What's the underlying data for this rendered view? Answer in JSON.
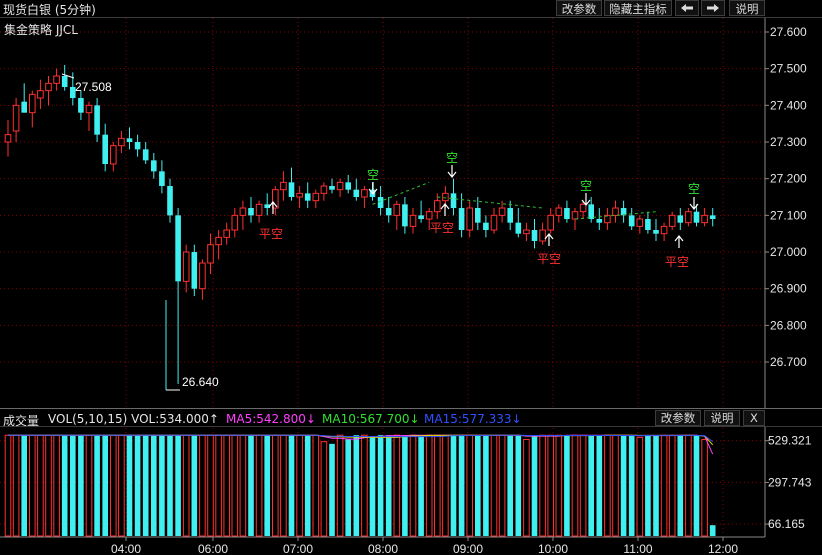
{
  "window": {
    "title": "现货白银 (5分钟)",
    "strategy": "集金策略 JJCL"
  },
  "toolbar": {
    "params": "改参数",
    "hide": "隐藏主指标",
    "left_icon": "arrow-left-icon",
    "right_icon": "arrow-right-icon",
    "help": "说明"
  },
  "price_axis": {
    "ticks": [
      "27.600",
      "27.500",
      "27.400",
      "27.300",
      "27.200",
      "27.100",
      "27.000",
      "26.900",
      "26.800",
      "26.700"
    ]
  },
  "time_axis": {
    "labels": [
      "04:00",
      "06:00",
      "07:00",
      "08:00",
      "09:00",
      "10:00",
      "11:00",
      "12:00"
    ]
  },
  "annotations": {
    "high": "27.508",
    "low": "26.640"
  },
  "signals": [
    {
      "text": "平空",
      "kind": "cover"
    },
    {
      "text": "空",
      "kind": "short"
    },
    {
      "text": "空",
      "kind": "short"
    },
    {
      "text": "平空",
      "kind": "cover"
    },
    {
      "text": "平空",
      "kind": "cover"
    },
    {
      "text": "空",
      "kind": "short"
    },
    {
      "text": "平空",
      "kind": "cover"
    },
    {
      "text": "空",
      "kind": "short"
    }
  ],
  "volume": {
    "label": "成交量",
    "vol": "VOL(5,10,15) VOL:534.000↑",
    "ma5": "MA5:542.800↓",
    "ma10": "MA10:567.700↓",
    "ma15": "MA15:577.333↓",
    "params": "改参数",
    "help": "说明",
    "close": "X",
    "ticks": [
      "529.321",
      "297.743",
      "66.165"
    ]
  },
  "colors": {
    "up": "#ff3030",
    "down": "#40f0f0",
    "ma5": "#ff40ff",
    "ma10": "#e0e000",
    "ma15": "#3050ff",
    "grid": "#8b0000",
    "signal_short": "#30e030",
    "signal_cover": "#ff3030"
  },
  "chart_data": {
    "type": "candlestick",
    "price_range": [
      26.6,
      27.63
    ],
    "price_ticks": [
      26.7,
      26.8,
      26.9,
      27.0,
      27.1,
      27.2,
      27.3,
      27.4,
      27.5,
      27.6
    ],
    "time_labels": [
      "04:00",
      "06:00",
      "07:00",
      "08:00",
      "09:00",
      "10:00",
      "11:00",
      "12:00"
    ],
    "candles": [
      [
        27.3,
        27.36,
        27.26,
        27.32
      ],
      [
        27.33,
        27.42,
        27.3,
        27.4
      ],
      [
        27.41,
        27.46,
        27.38,
        27.38
      ],
      [
        27.38,
        27.44,
        27.34,
        27.43
      ],
      [
        27.42,
        27.47,
        27.39,
        27.44
      ],
      [
        27.44,
        27.48,
        27.4,
        27.46
      ],
      [
        27.46,
        27.5,
        27.44,
        27.48
      ],
      [
        27.48,
        27.51,
        27.44,
        27.45
      ],
      [
        27.45,
        27.49,
        27.4,
        27.42
      ],
      [
        27.42,
        27.44,
        27.36,
        27.38
      ],
      [
        27.38,
        27.41,
        27.33,
        27.4
      ],
      [
        27.4,
        27.42,
        27.3,
        27.32
      ],
      [
        27.32,
        27.35,
        27.22,
        27.24
      ],
      [
        27.24,
        27.3,
        27.22,
        27.29
      ],
      [
        27.29,
        27.33,
        27.27,
        27.31
      ],
      [
        27.31,
        27.34,
        27.28,
        27.3
      ],
      [
        27.3,
        27.32,
        27.26,
        27.28
      ],
      [
        27.28,
        27.3,
        27.24,
        27.25
      ],
      [
        27.25,
        27.27,
        27.2,
        27.22
      ],
      [
        27.22,
        27.25,
        27.16,
        27.18
      ],
      [
        27.18,
        27.2,
        27.08,
        27.1
      ],
      [
        27.1,
        27.12,
        26.64,
        26.92
      ],
      [
        26.92,
        27.02,
        26.89,
        27.0
      ],
      [
        27.0,
        27.02,
        26.88,
        26.9
      ],
      [
        26.9,
        26.98,
        26.87,
        26.97
      ],
      [
        26.97,
        27.05,
        26.94,
        27.02
      ],
      [
        27.02,
        27.06,
        26.98,
        27.04
      ],
      [
        27.04,
        27.08,
        27.02,
        27.06
      ],
      [
        27.06,
        27.12,
        27.04,
        27.1
      ],
      [
        27.1,
        27.14,
        27.06,
        27.12
      ],
      [
        27.12,
        27.15,
        27.08,
        27.1
      ],
      [
        27.1,
        27.14,
        27.08,
        27.13
      ],
      [
        27.13,
        27.16,
        27.1,
        27.12
      ],
      [
        27.12,
        27.18,
        27.1,
        27.17
      ],
      [
        27.17,
        27.22,
        27.14,
        27.19
      ],
      [
        27.19,
        27.23,
        27.14,
        27.15
      ],
      [
        27.15,
        27.18,
        27.12,
        27.16
      ],
      [
        27.16,
        27.19,
        27.12,
        27.14
      ],
      [
        27.14,
        27.17,
        27.12,
        27.16
      ],
      [
        27.16,
        27.19,
        27.14,
        27.18
      ],
      [
        27.18,
        27.2,
        27.16,
        27.17
      ],
      [
        27.17,
        27.2,
        27.15,
        27.19
      ],
      [
        27.19,
        27.21,
        27.16,
        27.17
      ],
      [
        27.17,
        27.2,
        27.14,
        27.15
      ],
      [
        27.15,
        27.18,
        27.12,
        27.17
      ],
      [
        27.17,
        27.19,
        27.14,
        27.15
      ],
      [
        27.15,
        27.18,
        27.1,
        27.12
      ],
      [
        27.12,
        27.15,
        27.08,
        27.1
      ],
      [
        27.1,
        27.14,
        27.06,
        27.13
      ],
      [
        27.13,
        27.15,
        27.05,
        27.07
      ],
      [
        27.07,
        27.12,
        27.05,
        27.1
      ],
      [
        27.1,
        27.14,
        27.08,
        27.09
      ],
      [
        27.09,
        27.12,
        27.06,
        27.11
      ],
      [
        27.11,
        27.16,
        27.09,
        27.14
      ],
      [
        27.14,
        27.18,
        27.12,
        27.16
      ],
      [
        27.16,
        27.2,
        27.1,
        27.12
      ],
      [
        27.12,
        27.16,
        27.04,
        27.06
      ],
      [
        27.06,
        27.14,
        27.04,
        27.12
      ],
      [
        27.12,
        27.15,
        27.06,
        27.08
      ],
      [
        27.08,
        27.1,
        27.04,
        27.06
      ],
      [
        27.06,
        27.12,
        27.05,
        27.1
      ],
      [
        27.1,
        27.14,
        27.08,
        27.12
      ],
      [
        27.12,
        27.14,
        27.06,
        27.08
      ],
      [
        27.08,
        27.12,
        27.04,
        27.05
      ],
      [
        27.05,
        27.08,
        27.03,
        27.06
      ],
      [
        27.06,
        27.09,
        27.01,
        27.03
      ],
      [
        27.03,
        27.08,
        27.02,
        27.06
      ],
      [
        27.06,
        27.12,
        27.05,
        27.1
      ],
      [
        27.1,
        27.13,
        27.08,
        27.12
      ],
      [
        27.12,
        27.14,
        27.08,
        27.09
      ],
      [
        27.09,
        27.12,
        27.06,
        27.11
      ],
      [
        27.11,
        27.14,
        27.09,
        27.13
      ],
      [
        27.13,
        27.15,
        27.08,
        27.09
      ],
      [
        27.09,
        27.12,
        27.06,
        27.08
      ],
      [
        27.08,
        27.12,
        27.06,
        27.1
      ],
      [
        27.1,
        27.14,
        27.08,
        27.12
      ],
      [
        27.12,
        27.14,
        27.08,
        27.1
      ],
      [
        27.1,
        27.12,
        27.06,
        27.07
      ],
      [
        27.07,
        27.1,
        27.05,
        27.09
      ],
      [
        27.09,
        27.11,
        27.05,
        27.06
      ],
      [
        27.06,
        27.09,
        27.03,
        27.05
      ],
      [
        27.05,
        27.08,
        27.03,
        27.07
      ],
      [
        27.07,
        27.11,
        27.06,
        27.1
      ],
      [
        27.1,
        27.12,
        27.06,
        27.08
      ],
      [
        27.08,
        27.12,
        27.07,
        27.11
      ],
      [
        27.11,
        27.13,
        27.07,
        27.08
      ],
      [
        27.08,
        27.12,
        27.07,
        27.1
      ],
      [
        27.1,
        27.12,
        27.07,
        27.09
      ]
    ],
    "volume_range": [
      0,
      600
    ],
    "volume_ticks": [
      529.321,
      297.743,
      66.165
    ]
  }
}
